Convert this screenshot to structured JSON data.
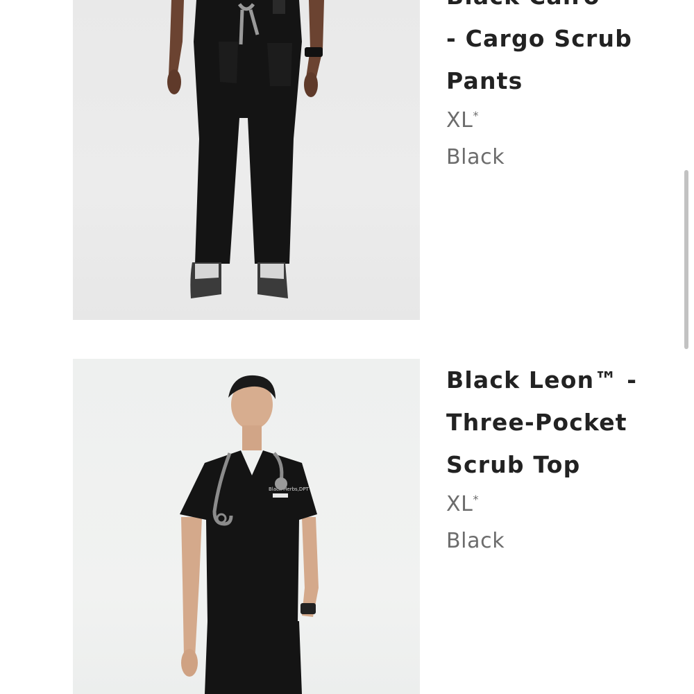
{
  "products": [
    {
      "title_partial": "Black Cairo™",
      "title_rest_1": "- Cargo Scrub",
      "title_rest_2": "Pants",
      "size": "XL",
      "size_marker": "*",
      "color": "Black"
    },
    {
      "title_line_1": "Black Leon™ -",
      "title_line_2": "Three-Pocket",
      "title_line_3": "Scrub Top",
      "size": "XL",
      "size_marker": "*",
      "color": "Black",
      "badge_text": "Black Herbs,DPT"
    }
  ],
  "colors": {
    "title": "#222222",
    "meta": "#6c6c6c",
    "scrubs": "#141414"
  }
}
